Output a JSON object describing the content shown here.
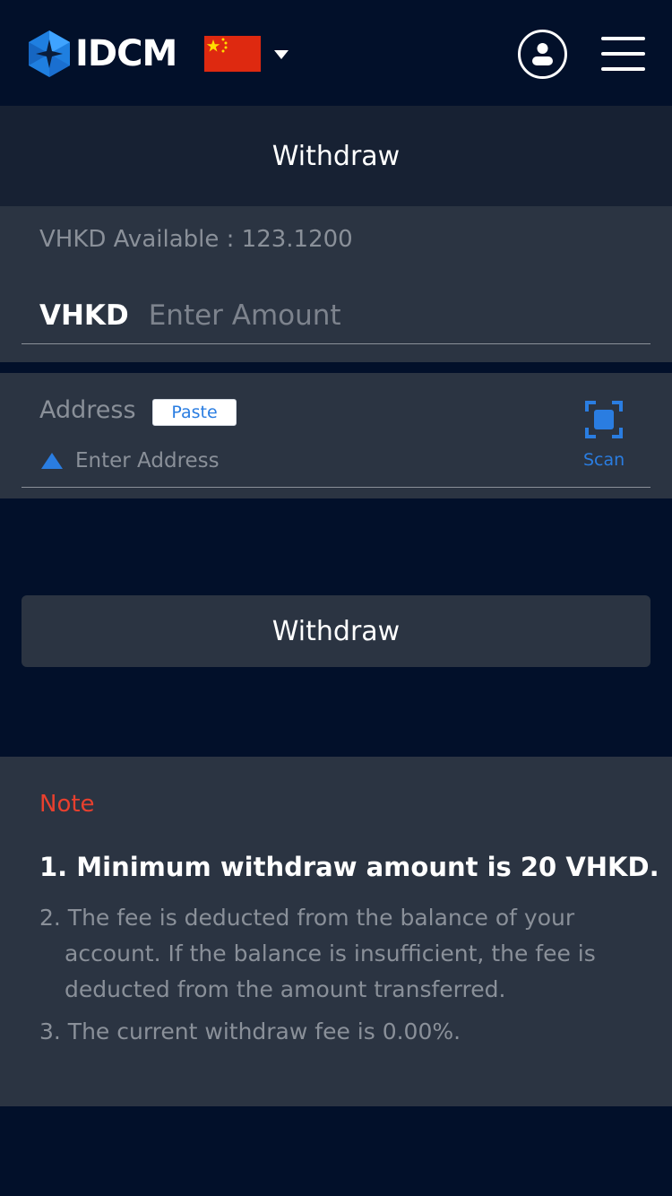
{
  "header": {
    "brand": "IDCM",
    "flag_country": "China",
    "flag_color": "#de2910"
  },
  "page": {
    "title": "Withdraw"
  },
  "amount": {
    "available_text": "VHKD Available : 123.1200",
    "currency": "VHKD",
    "placeholder": "Enter Amount",
    "value": ""
  },
  "address": {
    "label": "Address",
    "paste_label": "Paste",
    "placeholder": "Enter Address",
    "value": "",
    "scan_label": "Scan"
  },
  "actions": {
    "withdraw_label": "Withdraw"
  },
  "notes": {
    "title": "Note",
    "items": [
      "1. Minimum withdraw amount is 20 VHKD.",
      "2. The fee is deducted from the balance of your account. If the balance is insufficient, the fee is deducted from the amount transferred.",
      "3. The current withdraw fee is 0.00%."
    ]
  },
  "colors": {
    "background": "#02102a",
    "panel": "#2b3442",
    "title_bar": "#172133",
    "accent_blue": "#2a7de1",
    "note_red": "#e8402e",
    "muted_text": "#8a9099"
  },
  "icons": {
    "logo": "idcm-logo-icon",
    "flag": "china-flag-icon",
    "caret": "caret-down-icon",
    "user": "user-icon",
    "menu": "hamburger-menu-icon",
    "address_type": "triangle-icon",
    "scan": "scan-icon"
  }
}
